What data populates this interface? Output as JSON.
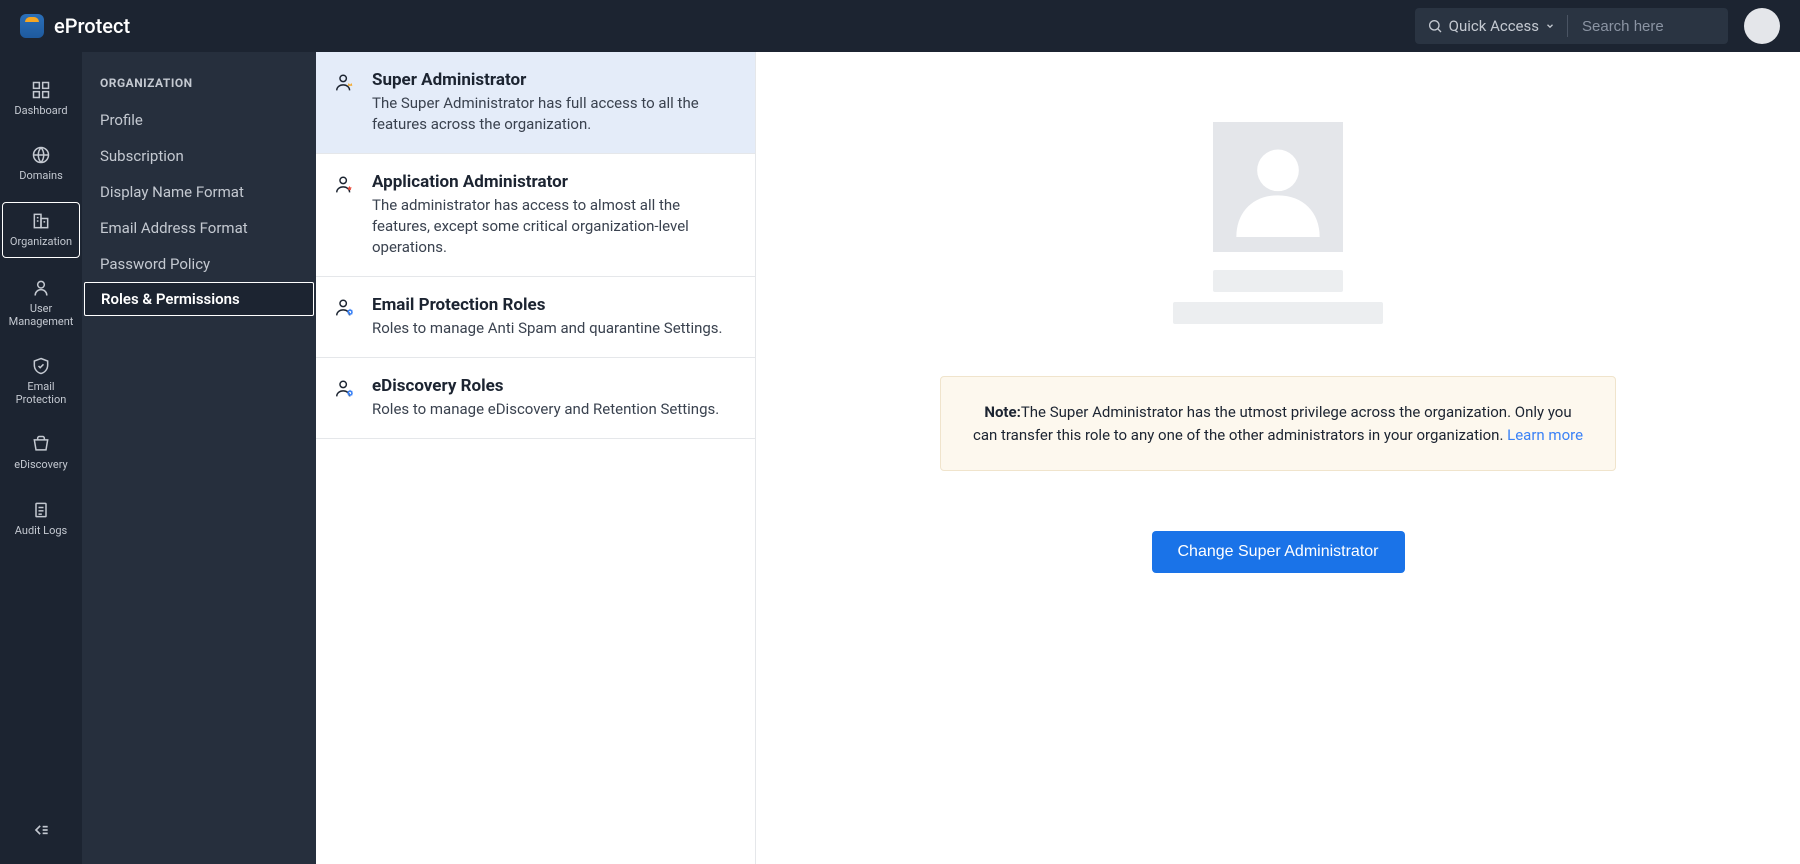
{
  "header": {
    "app_name": "eProtect",
    "quick_access_label": "Quick Access",
    "search_placeholder": "Search here"
  },
  "nav_rail": {
    "items": [
      {
        "label": "Dashboard"
      },
      {
        "label": "Domains"
      },
      {
        "label": "Organization"
      },
      {
        "label": "User Management"
      },
      {
        "label": "Email Protection"
      },
      {
        "label": "eDiscovery"
      },
      {
        "label": "Audit Logs"
      }
    ]
  },
  "sub_nav": {
    "heading": "ORGANIZATION",
    "items": [
      {
        "label": "Profile"
      },
      {
        "label": "Subscription"
      },
      {
        "label": "Display Name Format"
      },
      {
        "label": "Email Address Format"
      },
      {
        "label": "Password Policy"
      },
      {
        "label": "Roles & Permissions"
      }
    ]
  },
  "roles": [
    {
      "title": "Super Administrator",
      "desc": "The Super Administrator has full access to all the features across the organization."
    },
    {
      "title": "Application Administrator",
      "desc": "The administrator has access to almost all the features, except some critical organization-level operations."
    },
    {
      "title": "Email Protection Roles",
      "desc": "Roles to manage Anti Spam and quarantine Settings."
    },
    {
      "title": "eDiscovery Roles",
      "desc": "Roles to manage eDiscovery and Retention Settings."
    }
  ],
  "detail": {
    "note_label": "Note:",
    "note_text": "The Super Administrator has the utmost privilege across the organization. Only you can transfer this role to any one of the other administrators in your organization. ",
    "learn_more": "Learn more",
    "change_button": "Change Super Administrator"
  }
}
